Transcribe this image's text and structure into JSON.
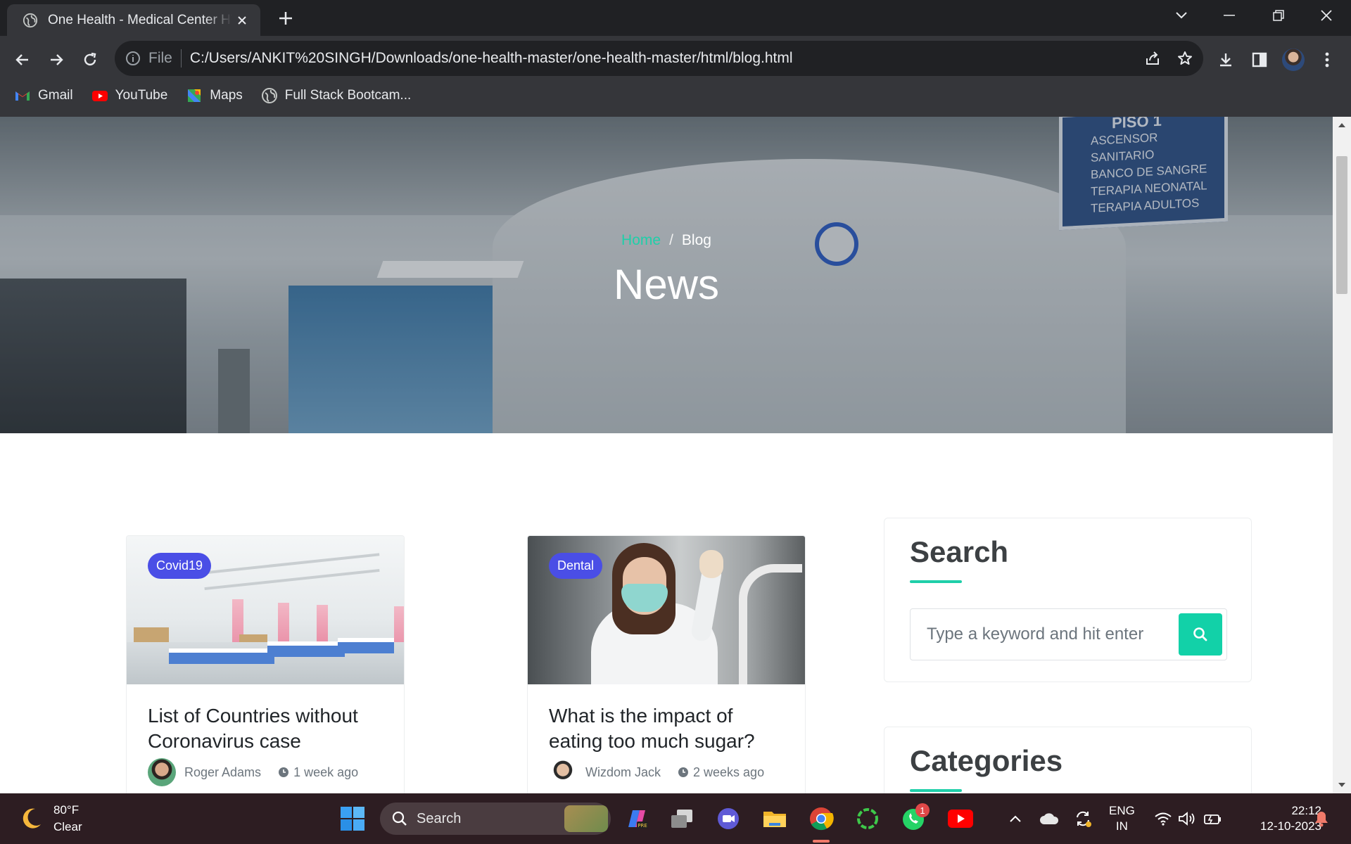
{
  "browser": {
    "tab_title": "One Health - Medical Center HTML",
    "address_prefix": "File",
    "url": "C:/Users/ANKIT%20SINGH/Downloads/one-health-master/one-health-master/html/blog.html",
    "bookmarks": [
      {
        "label": "Gmail",
        "icon": "gmail-icon"
      },
      {
        "label": "YouTube",
        "icon": "youtube-icon"
      },
      {
        "label": "Maps",
        "icon": "maps-icon"
      },
      {
        "label": "Full Stack Bootcam...",
        "icon": "globe-icon"
      }
    ]
  },
  "page": {
    "breadcrumb": {
      "home": "Home",
      "separator": "/",
      "current": "Blog"
    },
    "hero_title": "News",
    "hero_sign_lines": [
      "PISO 1",
      "ASCENSOR",
      "SANITARIO",
      "BANCO DE SANGRE",
      "TERAPIA NEONATAL",
      "TERAPIA ADULTOS"
    ],
    "posts": [
      {
        "category": "Covid19",
        "title": "List of Countries without Coronavirus case",
        "author": "Roger Adams",
        "time": "1 week ago"
      },
      {
        "category": "Dental",
        "title": "What is the impact of eating too much sugar?",
        "author": "Wizdom Jack",
        "time": "2 weeks ago"
      }
    ],
    "sidebar": {
      "search_title": "Search",
      "search_placeholder": "Type a keyword and hit enter",
      "categories_title": "Categories"
    },
    "accent_color": "#1fcfa9",
    "badge_color": "#4a4ee6"
  },
  "taskbar": {
    "weather_temp": "80°F",
    "weather_desc": "Clear",
    "search_label": "Search",
    "whatsapp_badge": "1",
    "lang_line1": "ENG",
    "lang_line2": "IN",
    "time": "22:12",
    "date": "12-10-2023",
    "apps": [
      "start-icon",
      "copilot-icon",
      "task-view-icon",
      "meet-icon",
      "file-explorer-icon",
      "chrome-icon",
      "circle-app-icon",
      "whatsapp-icon",
      "youtube-app-icon"
    ]
  }
}
